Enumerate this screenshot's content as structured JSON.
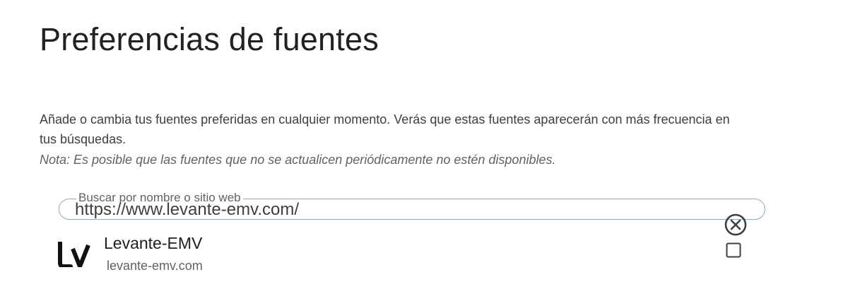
{
  "page": {
    "title": "Preferencias de fuentes",
    "description": "Añade o cambia tus fuentes preferidas en cualquier momento. Verás que estas fuentes aparecerán con más frecuencia en tus búsquedas.",
    "note": "Nota: Es posible que las fuentes que no se actualicen periódicamente no estén disponibles."
  },
  "search": {
    "label": "Buscar por nombre o sitio web",
    "value": "https://www.levante-emv.com/",
    "clear_icon": "close-circle-icon"
  },
  "results": [
    {
      "name": "Levante-EMV",
      "domain": "levante-emv.com",
      "logo_text": "Lv",
      "checked": false,
      "checkbox_icon": "checkbox-unchecked-icon"
    }
  ],
  "colors": {
    "search_border": "#8fa9c7",
    "text_primary": "#202124",
    "text_secondary": "#5f6368"
  }
}
